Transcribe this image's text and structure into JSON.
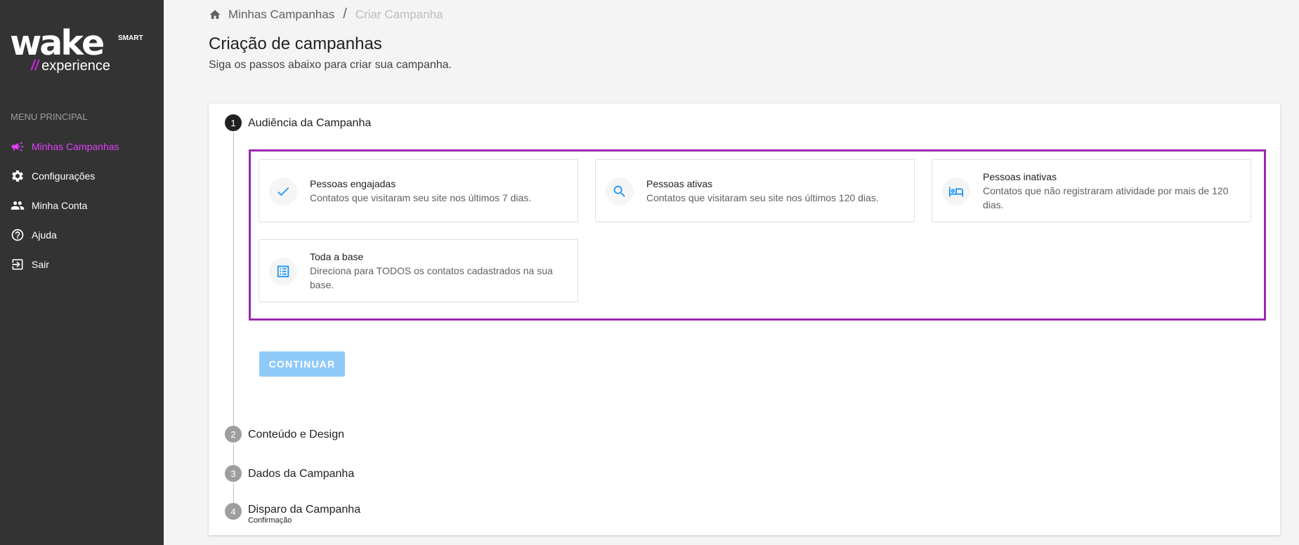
{
  "logo": {
    "wake_pre": "wa",
    "wake_accent": "k",
    "wake_post": "e",
    "smart": "SMART",
    "slashes": "//",
    "experience": "experience"
  },
  "sidebar": {
    "menu_title": "MENU PRINCIPAL",
    "items": [
      {
        "label": "Minhas Campanhas",
        "icon": "megaphone-icon",
        "active": true
      },
      {
        "label": "Configurações",
        "icon": "gear-icon",
        "active": false
      },
      {
        "label": "Minha Conta",
        "icon": "people-icon",
        "active": false
      },
      {
        "label": "Ajuda",
        "icon": "help-circle-icon",
        "active": false
      },
      {
        "label": "Sair",
        "icon": "logout-icon",
        "active": false
      }
    ]
  },
  "breadcrumb": {
    "icon": "home-icon",
    "link": "Minhas Campanhas",
    "separator": "/",
    "current": "Criar Campanha"
  },
  "header": {
    "title": "Criação de campanhas",
    "subtitle": "Siga os passos abaixo para criar sua campanha."
  },
  "steps": [
    {
      "number": "1",
      "label": "Audiência da Campanha"
    },
    {
      "number": "2",
      "label": "Conteúdo e Design"
    },
    {
      "number": "3",
      "label": "Dados da Campanha"
    },
    {
      "number": "4",
      "label": "Disparo da Campanha",
      "sublabel": "Confirmação"
    }
  ],
  "audience_options": [
    {
      "title": "Pessoas engajadas",
      "description": "Contatos que visitaram seu site nos últimos 7 dias.",
      "icon": "check-icon"
    },
    {
      "title": "Pessoas ativas",
      "description": "Contatos que visitaram seu site nos últimos 120 dias.",
      "icon": "search-icon"
    },
    {
      "title": "Pessoas inativas",
      "description": "Contatos que não registraram atividade por mais de 120 dias.",
      "icon": "bed-icon"
    },
    {
      "title": "Toda a base",
      "description": "Direciona para TODOS os contatos cadastrados na sua base.",
      "icon": "list-icon"
    }
  ],
  "continue_label": "CONTINUAR",
  "colors": {
    "sidebar_bg": "#333333",
    "accent": "#e040fb",
    "icon_blue": "#2196f3",
    "highlight_border": "#9c27b0",
    "button_disabled": "#90caf9"
  }
}
